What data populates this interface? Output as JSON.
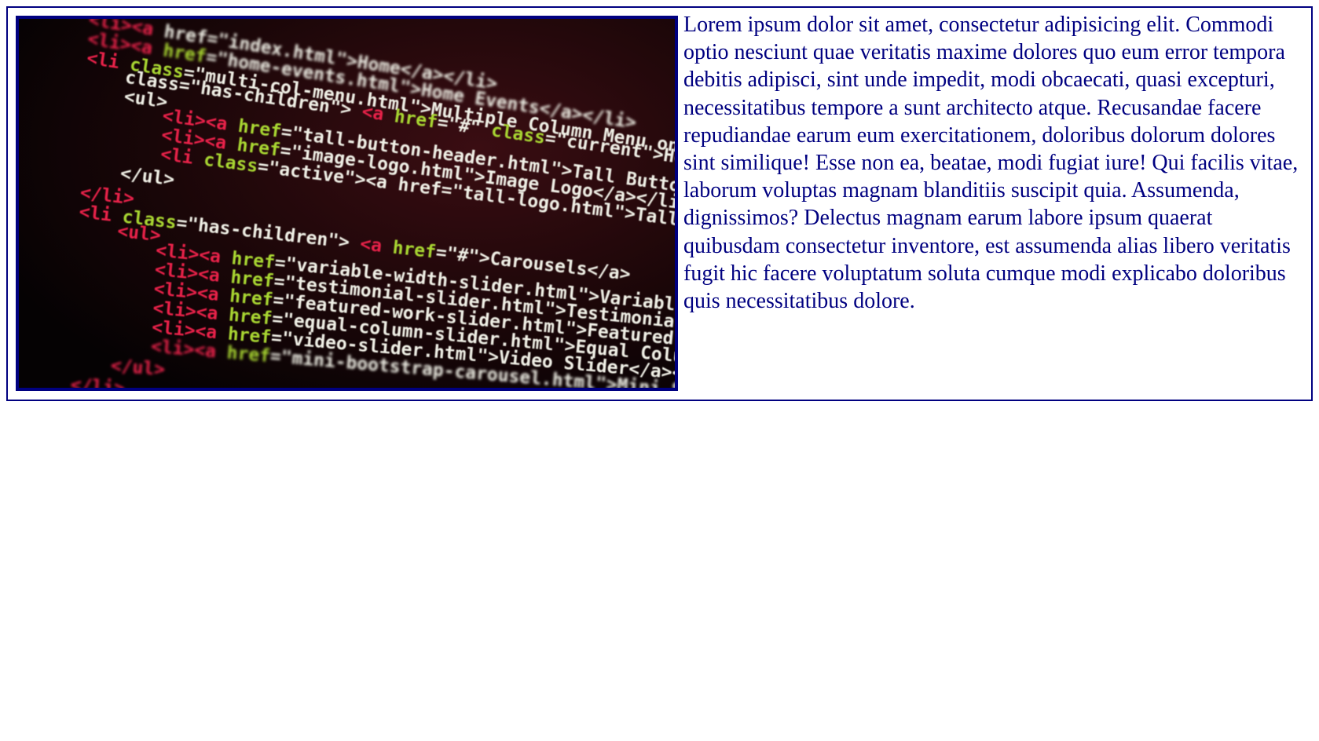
{
  "image": {
    "alt_semantic": "code-screenshot-photo",
    "code_lines": [
      {
        "indent": 0,
        "parts": [
          [
            "tag",
            "<li><a "
          ],
          [
            "text",
            "href=\"index.html\">Home</a></li>"
          ]
        ]
      },
      {
        "indent": 0,
        "parts": [
          [
            "tag",
            "<li><a "
          ],
          [
            "attr",
            "href"
          ],
          [
            "text",
            "=\"home-events.html\">Home Events</a></li>"
          ]
        ]
      },
      {
        "indent": 0,
        "parts": [
          [
            "tag",
            "<li "
          ],
          [
            "attr",
            "class"
          ],
          [
            "text",
            "=\"multi-col-menu.html\">Multiple Column Menu on Larger Viewports"
          ]
        ]
      },
      {
        "indent": 1,
        "parts": [
          [
            "text",
            "class=\"has-children\"> "
          ],
          [
            "tag",
            "<a "
          ],
          [
            "attr",
            "href"
          ],
          [
            "text",
            "=\"#\" "
          ],
          [
            "attr",
            "class"
          ],
          [
            "text",
            "=\"current\">Header Options</a>"
          ]
        ]
      },
      {
        "indent": 1,
        "parts": [
          [
            "text",
            "<ul>"
          ]
        ]
      },
      {
        "indent": 2,
        "parts": [
          [
            "tag",
            "<li><a "
          ],
          [
            "attr",
            "href"
          ],
          [
            "text",
            "=\"tall-button-header.html\">Tall Button Header</a></li>"
          ]
        ]
      },
      {
        "indent": 2,
        "parts": [
          [
            "tag",
            "<li><a "
          ],
          [
            "attr",
            "href"
          ],
          [
            "text",
            "=\"image-logo.html\">Image Logo</a></li>"
          ]
        ]
      },
      {
        "indent": 2,
        "parts": [
          [
            "tag",
            "<li "
          ],
          [
            "attr",
            "class"
          ],
          [
            "text",
            "=\"active\"><a href=\"tall-logo.html\">Tall Logo Image</a>"
          ]
        ]
      },
      {
        "indent": 1,
        "parts": [
          [
            "text",
            "</ul>"
          ]
        ]
      },
      {
        "indent": 0,
        "parts": [
          [
            "tag",
            "</li>"
          ]
        ]
      },
      {
        "indent": 0,
        "parts": [
          [
            "tag",
            "<li "
          ],
          [
            "attr",
            "class"
          ],
          [
            "text",
            "=\"has-children\"> "
          ],
          [
            "tag",
            "<a "
          ],
          [
            "attr",
            "href"
          ],
          [
            "text",
            "=\"#\">Carousels</a>"
          ]
        ]
      },
      {
        "indent": 1,
        "parts": [
          [
            "tag",
            "<ul>"
          ]
        ]
      },
      {
        "indent": 2,
        "parts": [
          [
            "tag",
            "<li><a "
          ],
          [
            "attr",
            "href"
          ],
          [
            "text",
            "=\"variable-width-slider.html\">Variable Image Width"
          ]
        ]
      },
      {
        "indent": 2,
        "parts": [
          [
            "tag",
            "<li><a "
          ],
          [
            "attr",
            "href"
          ],
          [
            "text",
            "=\"testimonial-slider.html\">Testimonial Slider</a>"
          ]
        ]
      },
      {
        "indent": 2,
        "parts": [
          [
            "tag",
            "<li><a "
          ],
          [
            "attr",
            "href"
          ],
          [
            "text",
            "=\"featured-work-slider.html\">Featured Work Slider"
          ]
        ]
      },
      {
        "indent": 2,
        "parts": [
          [
            "tag",
            "<li><a "
          ],
          [
            "attr",
            "href"
          ],
          [
            "text",
            "=\"equal-column-slider.html\">Equal Column Slider"
          ]
        ]
      },
      {
        "indent": 2,
        "parts": [
          [
            "tag",
            "<li><a "
          ],
          [
            "attr",
            "href"
          ],
          [
            "text",
            "=\"video-slider.html\">Video Slider</a></li>"
          ]
        ]
      },
      {
        "indent": 2,
        "parts": [
          [
            "tag",
            "<li><a "
          ],
          [
            "attr",
            "href"
          ],
          [
            "text",
            "=\"mini-bootstrap-carousel.html\">Mini Slider</a>"
          ]
        ]
      },
      {
        "indent": 1,
        "parts": [
          [
            "tag",
            "</ul>"
          ]
        ]
      },
      {
        "indent": 0,
        "parts": [
          [
            "tag",
            "</li>"
          ]
        ]
      }
    ],
    "colors": {
      "tag": "#e8204a",
      "attr": "#a8d632",
      "text": "#f0f0e6",
      "background": "#0a0608",
      "glow": "#3a0d12"
    }
  },
  "paragraph": {
    "text": "Lorem ipsum dolor sit amet, consectetur adipisicing elit. Commodi optio nesciunt quae veritatis maxime dolores quo eum error tempora debitis adipisci, sint unde impedit, modi obcaecati, quasi excepturi, necessitatibus tempore a sunt architecto atque. Recusandae facere repudiandae earum eum exercitationem, doloribus dolorum dolores sint similique! Esse non ea, beatae, modi fugiat iure! Qui facilis vitae, laborum voluptas magnam blanditiis suscipit quia. Assumenda, dignissimos? Delectus magnam earum labore ipsum quaerat quibusdam consectetur inventore, est assumenda alias libero veritatis fugit hic facere voluptatum soluta cumque modi explicabo doloribus quis necessitatibus dolore."
  },
  "theme": {
    "border": "#000080",
    "text": "#000080"
  }
}
